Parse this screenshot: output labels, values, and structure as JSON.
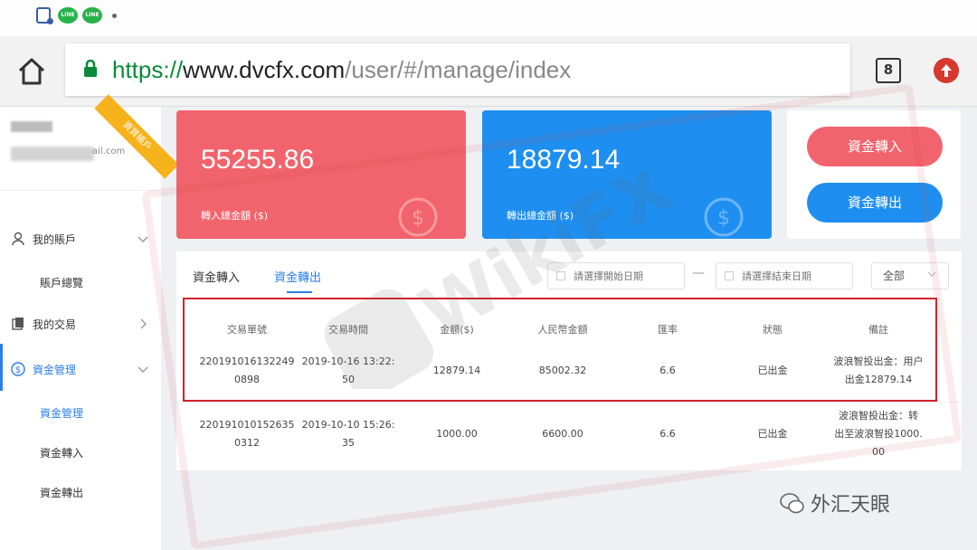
{
  "browser": {
    "url_scheme": "https://",
    "url_host": "www.dvcfx.com",
    "url_path": "/user/#/manage/index",
    "tab_count": "8"
  },
  "status_bar": {
    "line_app_label": "LINE"
  },
  "sidebar": {
    "email_suffix": "ail.com",
    "ribbon": "資質帳戶",
    "items": [
      {
        "label": "我的賬戶",
        "icon": "user-icon"
      },
      {
        "label": "我的交易",
        "icon": "trade-icon"
      },
      {
        "label": "資金管理",
        "icon": "dollar-icon"
      }
    ],
    "sub_account": "賬戶總覽",
    "sub_funds": [
      "資金管理",
      "資金轉入",
      "資金轉出"
    ]
  },
  "cards": {
    "in_total": "55255.86",
    "in_label": "轉入總金額 ($)",
    "out_total": "18879.14",
    "out_label": "轉出總金額 ($)"
  },
  "actions": {
    "deposit": "資金轉入",
    "withdraw": "資金轉出"
  },
  "filters": {
    "tab_in": "資金轉入",
    "tab_out": "資金轉出",
    "start_placeholder": "請選擇開始日期",
    "end_placeholder": "請選擇結束日期",
    "separator": "—",
    "status_selected": "全部"
  },
  "table": {
    "headers": [
      "交易單號",
      "交易時間",
      "金額($)",
      "人民幣金額",
      "匯率",
      "狀態",
      "備註"
    ],
    "rows": [
      {
        "order_no": "2201910161322490898",
        "time": "2019-10-16 13:22:50",
        "amount": "12879.14",
        "rmb": "85002.32",
        "rate": "6.6",
        "status": "已出金",
        "note": "波浪智投出金：用户出金12879.14"
      },
      {
        "order_no": "2201910101526350312",
        "time": "2019-10-10 15:26:35",
        "amount": "1000.00",
        "rmb": "6600.00",
        "rate": "6.6",
        "status": "已出金",
        "note": "波浪智投出金：转出至波浪智投1000.00"
      }
    ]
  },
  "watermark": {
    "text": "WikiFX",
    "brand": "外汇天眼"
  },
  "colors": {
    "red": "#f2646d",
    "blue": "#1e8ff0",
    "highlight": "#d3222b",
    "ssl_green": "#0a8a3a"
  }
}
